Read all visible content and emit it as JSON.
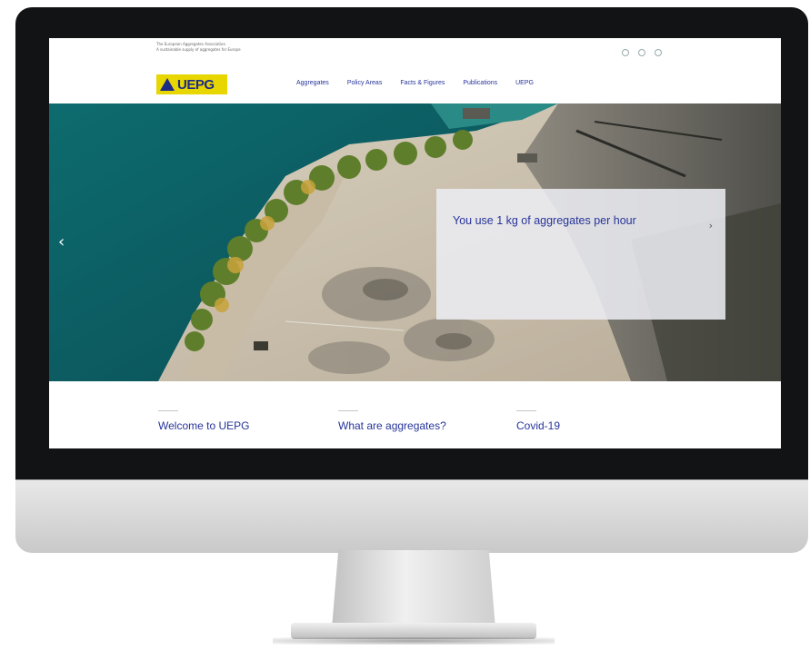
{
  "header": {
    "tagline_line1": "The European Aggregates Association",
    "tagline_line2": "A sustainable supply of aggregates for Europe",
    "logo_text": "UEPG",
    "icons": [
      "search-icon",
      "globe-icon",
      "user-icon"
    ]
  },
  "nav": {
    "items": [
      {
        "label": "Aggregates"
      },
      {
        "label": "Policy Areas"
      },
      {
        "label": "Facts & Figures"
      },
      {
        "label": "Publications"
      },
      {
        "label": "UEPG"
      }
    ]
  },
  "hero": {
    "card_title": "You use 1 kg of aggregates per hour",
    "card_subtitle": "",
    "card_text": "",
    "prev_arrow": "‹",
    "next_arrow": "›"
  },
  "links": {
    "items": [
      {
        "label": "Welcome to UEPG"
      },
      {
        "label": "What are aggregates?"
      },
      {
        "label": "Covid-19"
      }
    ]
  },
  "colors": {
    "brand_blue": "#27349a",
    "brand_yellow": "#e7d600",
    "bezel": "#121314"
  }
}
